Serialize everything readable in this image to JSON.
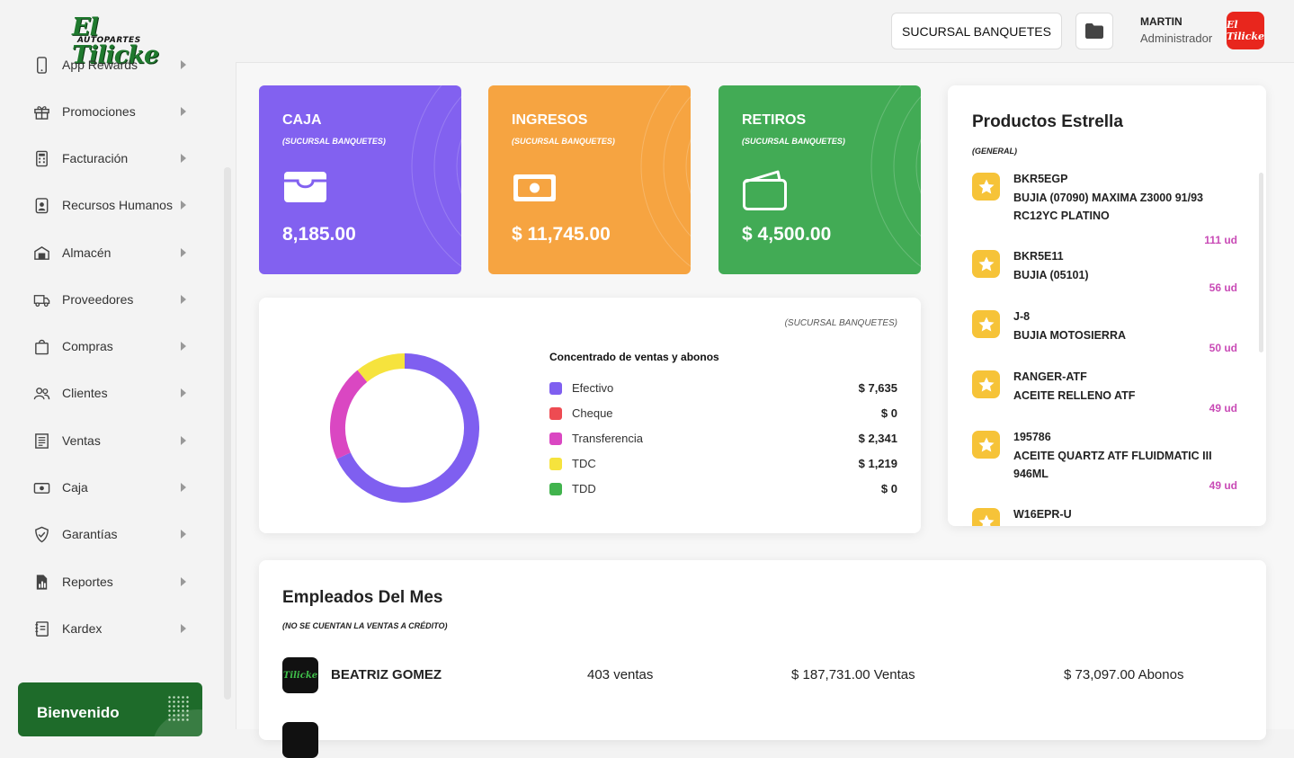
{
  "brand": {
    "logo_top": "El Tilicke",
    "logo_bottom": "AUTOPARTES"
  },
  "sidebar": {
    "items": [
      {
        "label": "App Rewards",
        "icon": "phone-icon"
      },
      {
        "label": "Promociones",
        "icon": "gift-icon"
      },
      {
        "label": "Facturación",
        "icon": "calculator-icon"
      },
      {
        "label": "Recursos Humanos",
        "icon": "id-badge-icon"
      },
      {
        "label": "Almacén",
        "icon": "warehouse-box-icon"
      },
      {
        "label": "Proveedores",
        "icon": "truck-icon"
      },
      {
        "label": "Compras",
        "icon": "shopping-bag-icon"
      },
      {
        "label": "Clientes",
        "icon": "users-icon"
      },
      {
        "label": "Ventas",
        "icon": "receipt-icon"
      },
      {
        "label": "Caja",
        "icon": "cash-icon"
      },
      {
        "label": "Garantías",
        "icon": "shield-check-icon"
      },
      {
        "label": "Reportes",
        "icon": "report-chart-icon"
      },
      {
        "label": "Kardex",
        "icon": "book-list-icon"
      }
    ],
    "welcome": "Bienvenido"
  },
  "header": {
    "branch": "SUCURSAL BANQUETES",
    "user_name": "MARTIN",
    "user_role": "Administrador"
  },
  "stats": [
    {
      "title": "CAJA",
      "sub": "(SUCURSAL BANQUETES)",
      "value": "8,185.00",
      "color": "#8261f0",
      "icon": "cash-drawer-icon"
    },
    {
      "title": "INGRESOS",
      "sub": "(SUCURSAL BANQUETES)",
      "value": "$ 11,745.00",
      "color": "#f6a441",
      "icon": "money-bill-icon"
    },
    {
      "title": "RETIROS",
      "sub": "(SUCURSAL BANQUETES)",
      "value": "$ 4,500.00",
      "color": "#42ab55",
      "icon": "wallet-icon"
    }
  ],
  "concentrado": {
    "branch": "(SUCURSAL BANQUETES)",
    "title": "Concentrado de ventas y abonos"
  },
  "chart_data": {
    "type": "pie",
    "title": "Concentrado de ventas y abonos",
    "categories": [
      "Efectivo",
      "Cheque",
      "Transferencia",
      "TDC",
      "TDD"
    ],
    "values": [
      7635,
      0,
      2341,
      1219,
      0
    ],
    "labels": [
      "$ 7,635",
      "$ 0",
      "$ 2,341",
      "$ 1,219",
      "$ 0"
    ],
    "colors": [
      "#7f5ff0",
      "#ee4b52",
      "#da47c2",
      "#f6e33d",
      "#41b34d"
    ],
    "donut": true
  },
  "productos": {
    "title": "Productos Estrella",
    "sub": "(GENERAL)",
    "items": [
      {
        "code": "BKR5EGP",
        "desc": "BUJIA (07090) MAXIMA Z3000 91/93 RC12YC PLATINO",
        "qty": "111 ud"
      },
      {
        "code": "BKR5E11",
        "desc": "BUJIA (05101)",
        "qty": "56 ud"
      },
      {
        "code": "J-8",
        "desc": "BUJIA MOTOSIERRA",
        "qty": "50 ud"
      },
      {
        "code": "RANGER-ATF",
        "desc": "ACEITE RELLENO ATF",
        "qty": "49 ud"
      },
      {
        "code": "195786",
        "desc": "ACEITE QUARTZ ATF FLUIDMATIC III 946ML",
        "qty": "49 ud"
      },
      {
        "code": "W16EPR-U",
        "desc": "",
        "qty": ""
      }
    ]
  },
  "empleados": {
    "title": "Empleados Del Mes",
    "sub": "(NO SE CUENTAN LA VENTAS A CRÉDITO)",
    "rows": [
      {
        "avatar": "Tilicke",
        "name": "BEATRIZ GOMEZ",
        "sales": "403 ventas",
        "amount": "$ 187,731.00 Ventas",
        "abonos": "$ 73,097.00 Abonos"
      }
    ]
  }
}
